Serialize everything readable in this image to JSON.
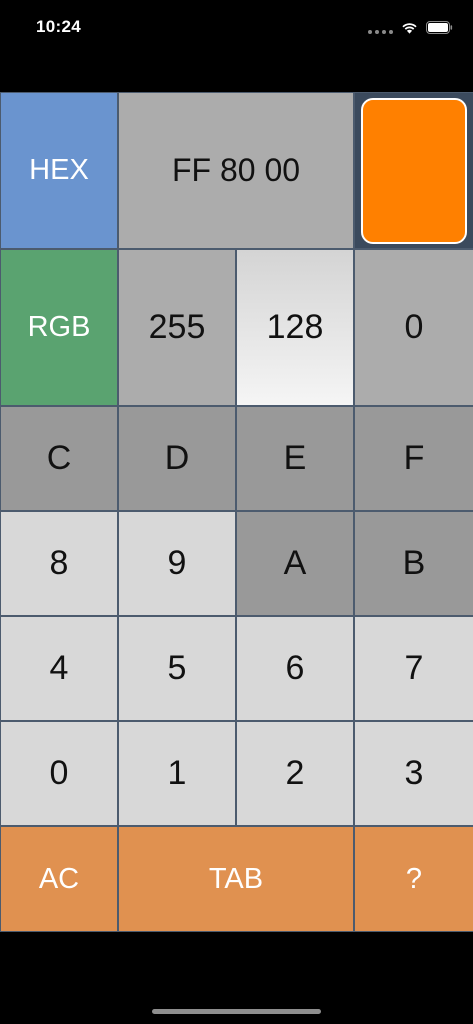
{
  "status_bar": {
    "time": "10:24",
    "icons": [
      "cellular-signal-icon",
      "wifi-icon",
      "battery-icon"
    ]
  },
  "color_display": {
    "hex_label": "HEX",
    "hex_value": "FF 80 00",
    "swatch_color": "#ff8000",
    "rgb_label": "RGB",
    "rgb_values": [
      "255",
      "128",
      "0"
    ],
    "active_channel_index": 1
  },
  "keypad": {
    "hex_row": [
      "C",
      "D",
      "E",
      "F"
    ],
    "row_8": [
      "8",
      "9",
      "A",
      "B"
    ],
    "row_4": [
      "4",
      "5",
      "6",
      "7"
    ],
    "row_0": [
      "0",
      "1",
      "2",
      "3"
    ],
    "actions": {
      "clear": "AC",
      "tab": "TAB",
      "help": "?"
    }
  },
  "colors": {
    "hex_tag": "#6a94cf",
    "rgb_tag": "#5aa370",
    "action_keys": "#e09150",
    "grid_lines": "#4c5b6e"
  }
}
